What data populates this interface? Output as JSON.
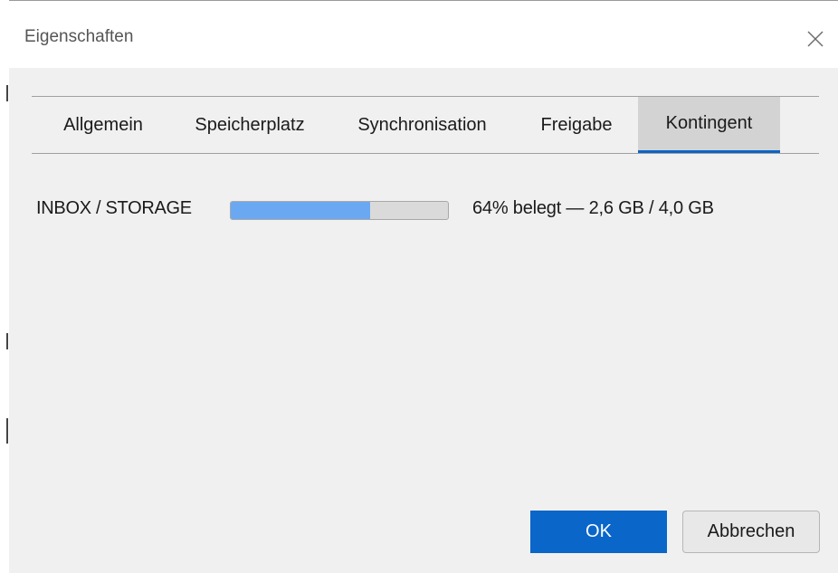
{
  "window": {
    "title": "Eigenschaften",
    "close_icon": "close-icon"
  },
  "tabs": [
    {
      "label": "Allgemein",
      "active": false
    },
    {
      "label": "Speicherplatz",
      "active": false
    },
    {
      "label": "Synchronisation",
      "active": false
    },
    {
      "label": "Freigabe",
      "active": false
    },
    {
      "label": "Kontingent",
      "active": true
    }
  ],
  "quota": {
    "folder_label": "INBOX / STORAGE",
    "used_percent": 64,
    "summary": "64% belegt — 2,6 GB / 4,0 GB"
  },
  "buttons": {
    "ok_label": "OK",
    "cancel_label": "Abbrechen"
  },
  "colors": {
    "accent": "#0a66c9",
    "progress_fill": "#6aa9f2",
    "active_tab_bg": "#d3d3d3"
  }
}
